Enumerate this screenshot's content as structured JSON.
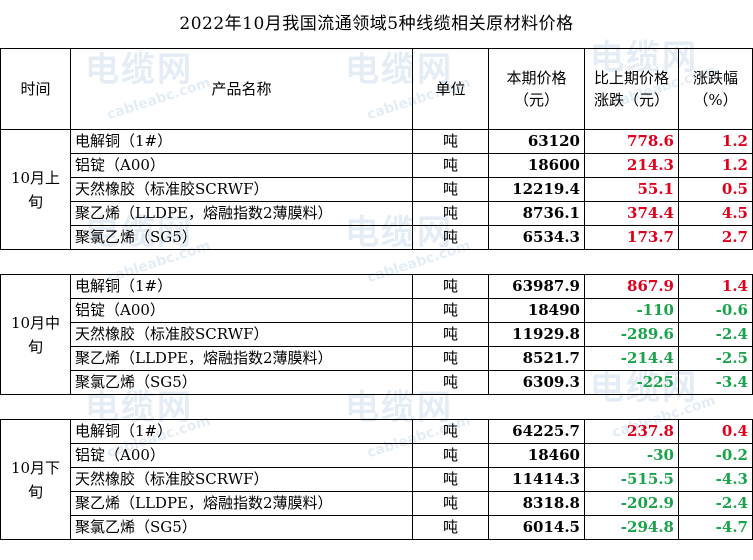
{
  "title": "2022年10月我国流通领域5种线缆相关原材料价格",
  "watermark": {
    "cn": "电缆网",
    "en": "cableabc.com"
  },
  "header": {
    "period": "时间",
    "product": "产品名称",
    "unit": "单位",
    "price": "本期价格（元）",
    "change": "比上期价格涨跌（元）",
    "pct": "涨跌幅（%）"
  },
  "colors": {
    "up": "#e0001b",
    "down": "#1aa34a"
  },
  "groups": [
    {
      "period": "10月上旬",
      "rows": [
        {
          "product": "电解铜（1#）",
          "unit": "吨",
          "price": "63120",
          "change": "778.6",
          "pct": "1.2"
        },
        {
          "product": "铝锭（A00）",
          "unit": "吨",
          "price": "18600",
          "change": "214.3",
          "pct": "1.2"
        },
        {
          "product": "天然橡胶（标准胶SCRWF）",
          "unit": "吨",
          "price": "12219.4",
          "change": "55.1",
          "pct": "0.5"
        },
        {
          "product": "聚乙烯（LLDPE，熔融指数2薄膜料）",
          "unit": "吨",
          "price": "8736.1",
          "change": "374.4",
          "pct": "4.5"
        },
        {
          "product": "聚氯乙烯（SG5）",
          "unit": "吨",
          "price": "6534.3",
          "change": "173.7",
          "pct": "2.7"
        }
      ]
    },
    {
      "period": "10月中旬",
      "rows": [
        {
          "product": "电解铜（1#）",
          "unit": "吨",
          "price": "63987.9",
          "change": "867.9",
          "pct": "1.4"
        },
        {
          "product": "铝锭（A00）",
          "unit": "吨",
          "price": "18490",
          "change": "-110",
          "pct": "-0.6"
        },
        {
          "product": "天然橡胶（标准胶SCRWF）",
          "unit": "吨",
          "price": "11929.8",
          "change": "-289.6",
          "pct": "-2.4"
        },
        {
          "product": "聚乙烯（LLDPE，熔融指数2薄膜料）",
          "unit": "吨",
          "price": "8521.7",
          "change": "-214.4",
          "pct": "-2.5"
        },
        {
          "product": "聚氯乙烯（SG5）",
          "unit": "吨",
          "price": "6309.3",
          "change": "-225",
          "pct": "-3.4"
        }
      ]
    },
    {
      "period": "10月下旬",
      "rows": [
        {
          "product": "电解铜（1#）",
          "unit": "吨",
          "price": "64225.7",
          "change": "237.8",
          "pct": "0.4"
        },
        {
          "product": "铝锭（A00）",
          "unit": "吨",
          "price": "18460",
          "change": "-30",
          "pct": "-0.2"
        },
        {
          "product": "天然橡胶（标准胶SCRWF）",
          "unit": "吨",
          "price": "11414.3",
          "change": "-515.5",
          "pct": "-4.3"
        },
        {
          "product": "聚乙烯（LLDPE，熔融指数2薄膜料）",
          "unit": "吨",
          "price": "8318.8",
          "change": "-202.9",
          "pct": "-2.4"
        },
        {
          "product": "聚氯乙烯（SG5）",
          "unit": "吨",
          "price": "6014.5",
          "change": "-294.8",
          "pct": "-4.7"
        }
      ]
    }
  ]
}
